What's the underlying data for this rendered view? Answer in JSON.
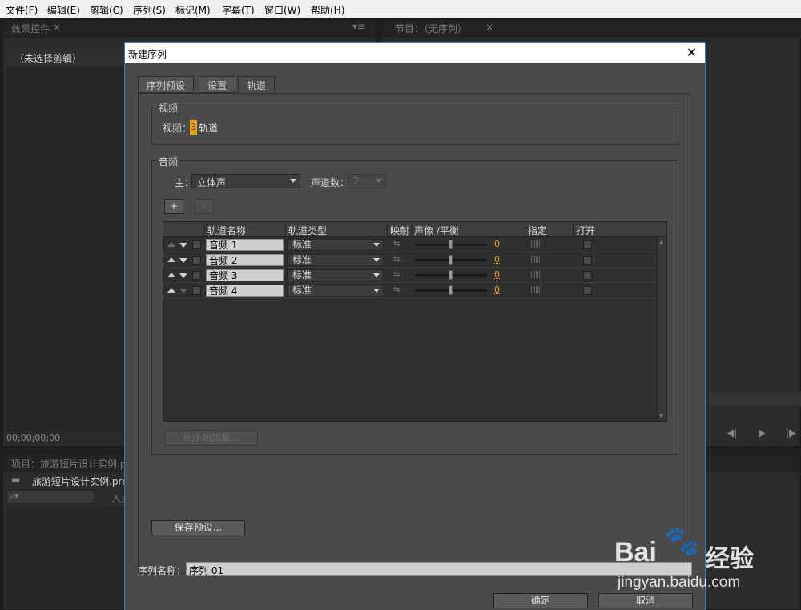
{
  "menubar": {
    "items": [
      "文件(F)",
      "编辑(E)",
      "剪辑(C)",
      "序列(S)",
      "标记(M)",
      "字幕(T)",
      "窗口(W)",
      "帮助(H)"
    ]
  },
  "background": {
    "effect_controls_tab": "效果控件",
    "no_clip_selected": "（未选择剪辑）",
    "program_tab": "节目：（无序列）",
    "timecode": "00;00;00;00",
    "project_tab": "项目：旅游短片设计实例.pr",
    "project_name": "旅游短片设计实例.pre",
    "in_label": "入点"
  },
  "dialog": {
    "title": "新建序列",
    "close": "✕",
    "tabs": [
      "序列预设",
      "设置",
      "轨道"
    ],
    "active_tab": "轨道",
    "video_group": "视频",
    "video_label": "视频：",
    "video_track_count": "3",
    "video_track_suffix": "轨道",
    "audio_group": "音频",
    "master_label": "主：",
    "master_value": "立体声",
    "channels_label": "声道数：",
    "channels_value": "2",
    "add_button": "+",
    "remove_button": "-",
    "table": {
      "headers": [
        "轨道名称",
        "轨道类型",
        "映射",
        "声像 /平衡",
        "指定",
        "打开"
      ],
      "rows": [
        {
          "name": "音频 1",
          "type": "标准",
          "pan": "0"
        },
        {
          "name": "音频 2",
          "type": "标准",
          "pan": "0"
        },
        {
          "name": "音频 3",
          "type": "标准",
          "pan": "0"
        },
        {
          "name": "音频 4",
          "type": "标准",
          "pan": "0"
        }
      ]
    },
    "load_from_sequence": "从序列加载...",
    "save_preset": "保存预设...",
    "sequence_name_label": "序列名称：",
    "sequence_name_value": "序列 01",
    "ok": "确定",
    "cancel": "取消"
  },
  "watermark": {
    "brand": "Bai",
    "brand_suffix": "经验",
    "url": "jingyan.baidu.com"
  }
}
